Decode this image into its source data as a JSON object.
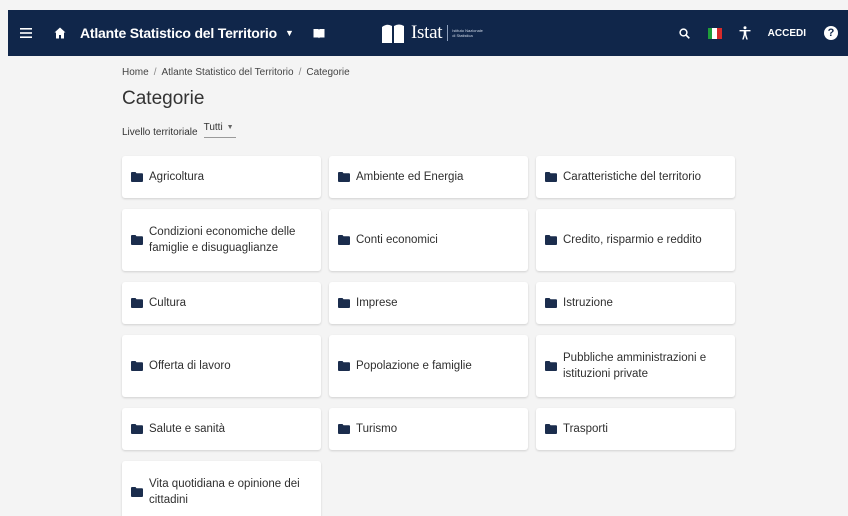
{
  "header": {
    "title": "Atlante Statistico del Territorio",
    "logo_text": "Istat",
    "logo_sub": "Istituto Nazionale di Statistica",
    "login_label": "ACCEDI",
    "help_label": "?"
  },
  "breadcrumb": [
    "Home",
    "Atlante Statistico del Territorio",
    "Categorie"
  ],
  "page_title": "Categorie",
  "filter": {
    "label": "Livello territoriale",
    "value": "Tutti"
  },
  "categories": [
    "Agricoltura",
    "Ambiente ed Energia",
    "Caratteristiche del territorio",
    "Condizioni economiche delle famiglie e disuguaglianze",
    "Conti economici",
    "Credito, risparmio e reddito",
    "Cultura",
    "Imprese",
    "Istruzione",
    "Offerta di lavoro",
    "Popolazione e famiglie",
    "Pubbliche amministrazioni e istituzioni private",
    "Salute e sanità",
    "Turismo",
    "Trasporti",
    "Vita quotidiana e opinione dei cittadini"
  ],
  "colors": {
    "header_bg": "#10264a",
    "page_bg": "#f4f4f4",
    "card_bg": "#ffffff",
    "icon": "#1b2d4d"
  }
}
